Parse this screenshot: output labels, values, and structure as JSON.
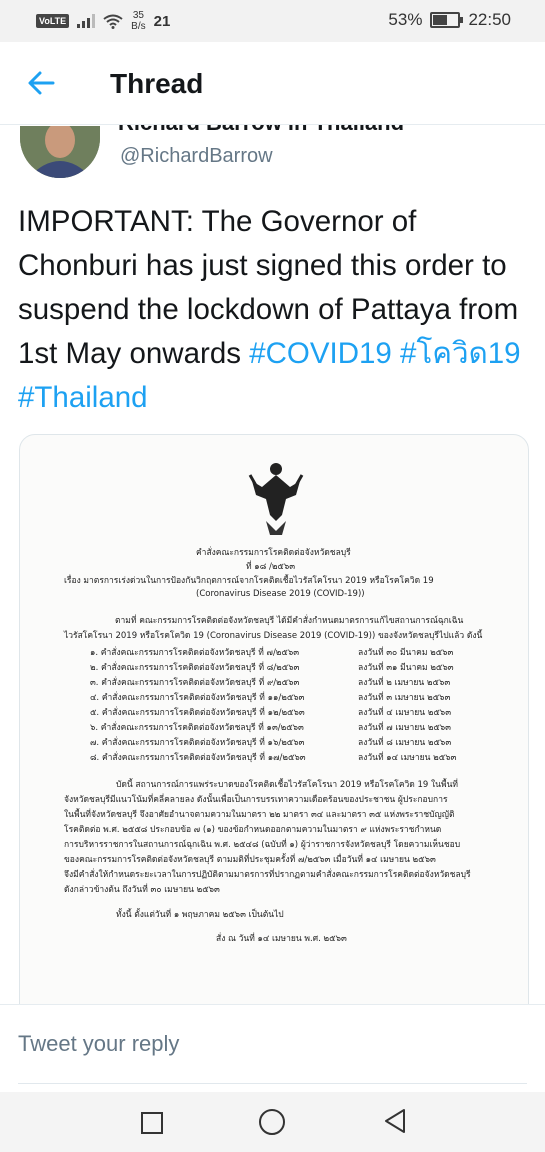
{
  "status_bar": {
    "volte": "VoLTE",
    "net_speed_value": "35",
    "net_speed_unit": "B/s",
    "notification_count": "21",
    "battery": "53%",
    "time": "22:50",
    "battery_level": 0.53
  },
  "app_bar": {
    "title": "Thread"
  },
  "tweet": {
    "author_name_cut": "Richard Barrow in Thailand",
    "handle": "@RichardBarrow",
    "text": "IMPORTANT: The Governor of Chonburi has just signed this order to suspend the lockdown of Pattaya from 1st May onwards",
    "hashtags": [
      "#COVID19",
      "#โควิด19",
      "#Thailand"
    ]
  },
  "document": {
    "heading": "คำสั่งคณะกรรมการโรคติดต่อจังหวัดชลบุรี",
    "number": "ที่ ๑๘ /๒๕๖๓",
    "subject": "เรื่อง  มาตรการเร่งด่วนในการป้องกันวิกฤตการณ์จากโรคติดเชื้อไวรัสโคโรนา 2019 หรือโรคโควิด 19",
    "subject_en": "(Coronavirus Disease 2019 (COVID-19))",
    "intro_1": "ตามที่ คณะกรรมการโรคติดต่อจังหวัดชลบุรี ได้มีคำสั่งกำหนดมาตรการแก้ไขสถานการณ์ฉุกเฉิน",
    "intro_2": "ไวรัสโคโรนา 2019 หรือโรคโควิด 19 (Coronavirus Disease 2019 (COVID-19)) ของจังหวัดชลบุรีไปแล้ว ดังนี้",
    "orders": [
      {
        "left": "๑. คำสั่งคณะกรรมการโรคติดต่อจังหวัดชลบุรี ที่ ๗/๒๕๖๓",
        "right": "ลงวันที่ ๓๐ มีนาคม ๒๕๖๓"
      },
      {
        "left": "๒. คำสั่งคณะกรรมการโรคติดต่อจังหวัดชลบุรี ที่ ๘/๒๕๖๓",
        "right": "ลงวันที่ ๓๑ มีนาคม ๒๕๖๓"
      },
      {
        "left": "๓. คำสั่งคณะกรรมการโรคติดต่อจังหวัดชลบุรี ที่ ๙/๒๕๖๓",
        "right": "ลงวันที่ ๒ เมษายน ๒๕๖๓"
      },
      {
        "left": "๔. คำสั่งคณะกรรมการโรคติดต่อจังหวัดชลบุรี ที่ ๑๑/๒๕๖๓",
        "right": "ลงวันที่ ๓ เมษายน ๒๕๖๓"
      },
      {
        "left": "๕. คำสั่งคณะกรรมการโรคติดต่อจังหวัดชลบุรี ที่ ๑๒/๒๕๖๓",
        "right": "ลงวันที่ ๔ เมษายน ๒๕๖๓"
      },
      {
        "left": "๖. คำสั่งคณะกรรมการโรคติดต่อจังหวัดชลบุรี ที่ ๑๓/๒๕๖๓",
        "right": "ลงวันที่ ๗ เมษายน ๒๕๖๓"
      },
      {
        "left": "๗. คำสั่งคณะกรรมการโรคติดต่อจังหวัดชลบุรี ที่ ๑๖/๒๕๖๓",
        "right": "ลงวันที่ ๘ เมษายน ๒๕๖๓"
      },
      {
        "left": "๘. คำสั่งคณะกรรมการโรคติดต่อจังหวัดชลบุรี ที่ ๑๗/๒๕๖๓",
        "right": "ลงวันที่ ๑๔ เมษายน ๒๕๖๓"
      }
    ],
    "body": [
      "บัดนี้ สถานการณ์การแพร่ระบาดของโรคติดเชื้อไวรัสโคโรนา 2019 หรือโรคโควิด 19 ในพื้นที่",
      "จังหวัดชลบุรีมีแนวโน้มที่คลี่คลายลง ดังนั้นเพื่อเป็นการบรรเทาความเดือดร้อนของประชาชน ผู้ประกอบการ",
      "ในพื้นที่จังหวัดชลบุรี จึงอาศัยอำนาจตามความในมาตรา ๒๒ มาตรา ๓๔ และมาตรา ๓๕ แห่งพระราชบัญญัติ",
      "โรคติดต่อ พ.ศ. ๒๕๕๘ ประกอบข้อ ๗ (๑) ของข้อกำหนดออกตามความในมาตรา ๙ แห่งพระราชกำหนด",
      "การบริหารราชการในสถานการณ์ฉุกเฉิน พ.ศ. ๒๕๔๘ (ฉบับที่ ๑) ผู้ว่าราชการจังหวัดชลบุรี โดยความเห็นชอบ",
      "ของคณะกรรมการโรคติดต่อจังหวัดชลบุรี ตามมติที่ประชุมครั้งที่ ๗/๒๕๖๓ เมื่อวันที่ ๑๔ เมษายน ๒๕๖๓",
      "จึงมีคำสั่งให้กำหนดระยะเวลาในการปฏิบัติตามมาตรการที่ปรากฏตามคำสั่งคณะกรรมการโรคติดต่อจังหวัดชลบุรี",
      "ดังกล่าวข้างต้น ถึงวันที่ ๓๐ เมษายน ๒๕๖๓"
    ],
    "effective": "ทั้งนี้ ตั้งแต่วันที่ ๑ พฤษภาคม ๒๕๖๓ เป็นต้นไป",
    "signed": "สั่ง ณ วันที่ ๑๔ เมษายน พ.ศ. ๒๕๖๓"
  },
  "reply": {
    "placeholder": "Tweet your reply"
  }
}
